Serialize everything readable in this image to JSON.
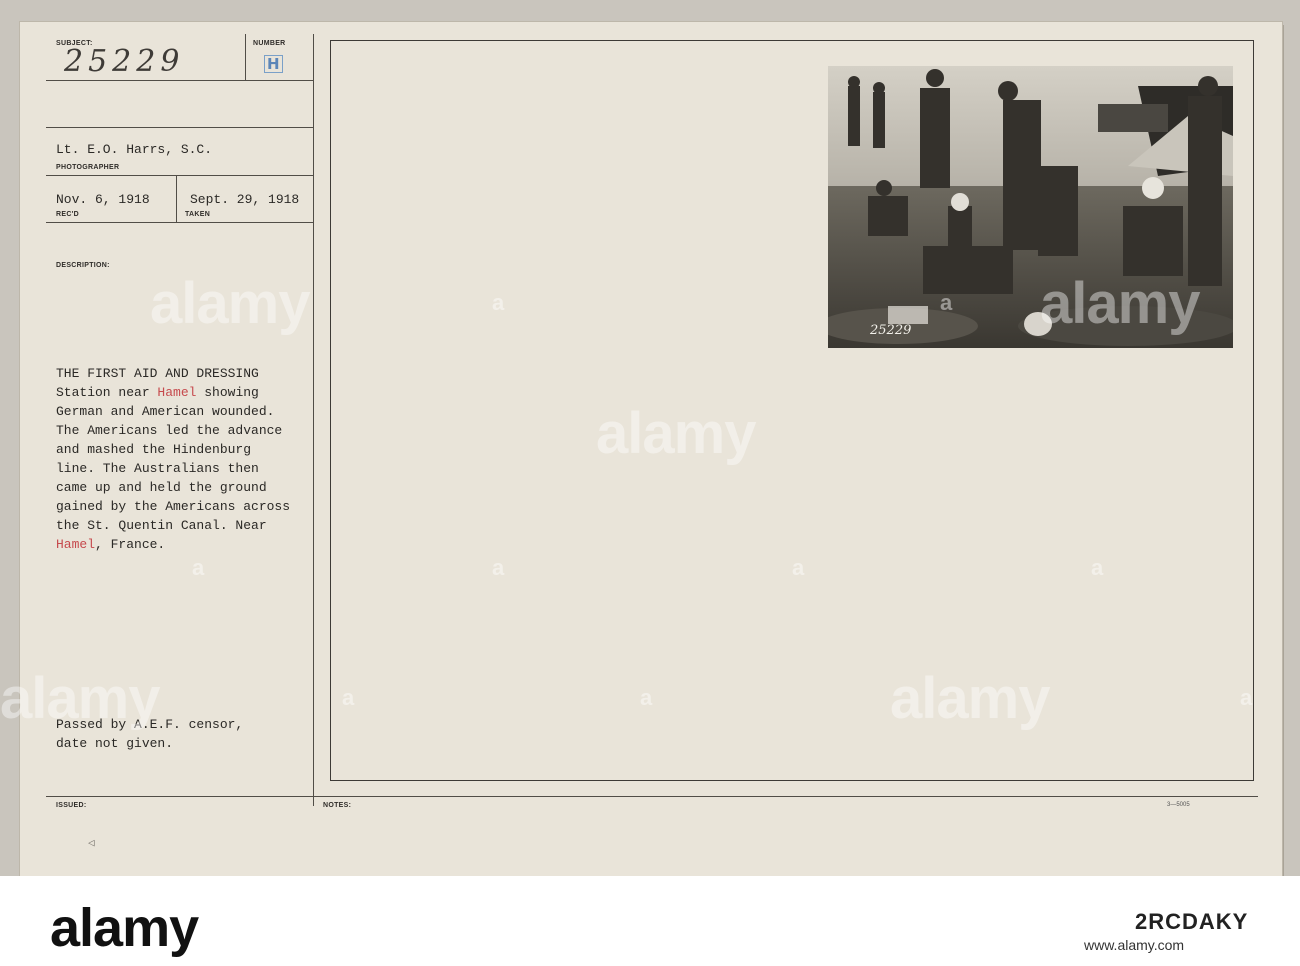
{
  "card": {
    "subject_label": "SUBJECT:",
    "number_label": "NUMBER",
    "subject_number": "25229",
    "number_stamp": "H",
    "photographer": "Lt. E.O. Harrs, S.C.",
    "photographer_label": "PHOTOGRAPHER",
    "received_date": "Nov. 6, 1918",
    "received_label": "REC'D",
    "taken_date": "Sept. 29, 1918",
    "taken_label": "TAKEN",
    "description_label": "DESCRIPTION:",
    "description_lines": [
      "THE FIRST AID AND DRESSING",
      "Station near ",
      "Hamel",
      " showing",
      "German and American wounded.",
      "The Americans led the advance",
      "and mashed the Hindenburg",
      "line. The Australians then",
      "came up and held the ground",
      "gained by the Americans across",
      "the St. Quentin Canal. Near",
      "Hamel",
      ", France."
    ],
    "censor_line1": "Passed by A.E.F. censor,",
    "censor_line2": "date not given.",
    "issued_label": "ISSUED:",
    "notes_label": "NOTES:",
    "form_code": "3—5005",
    "photo_number": "25229",
    "highlight_color": "#c64a4d"
  },
  "watermark": {
    "text": "alamy",
    "short": "a"
  },
  "footer": {
    "logo": "alamy",
    "image_id": "2RCDAKY",
    "url": "www.alamy.com"
  }
}
